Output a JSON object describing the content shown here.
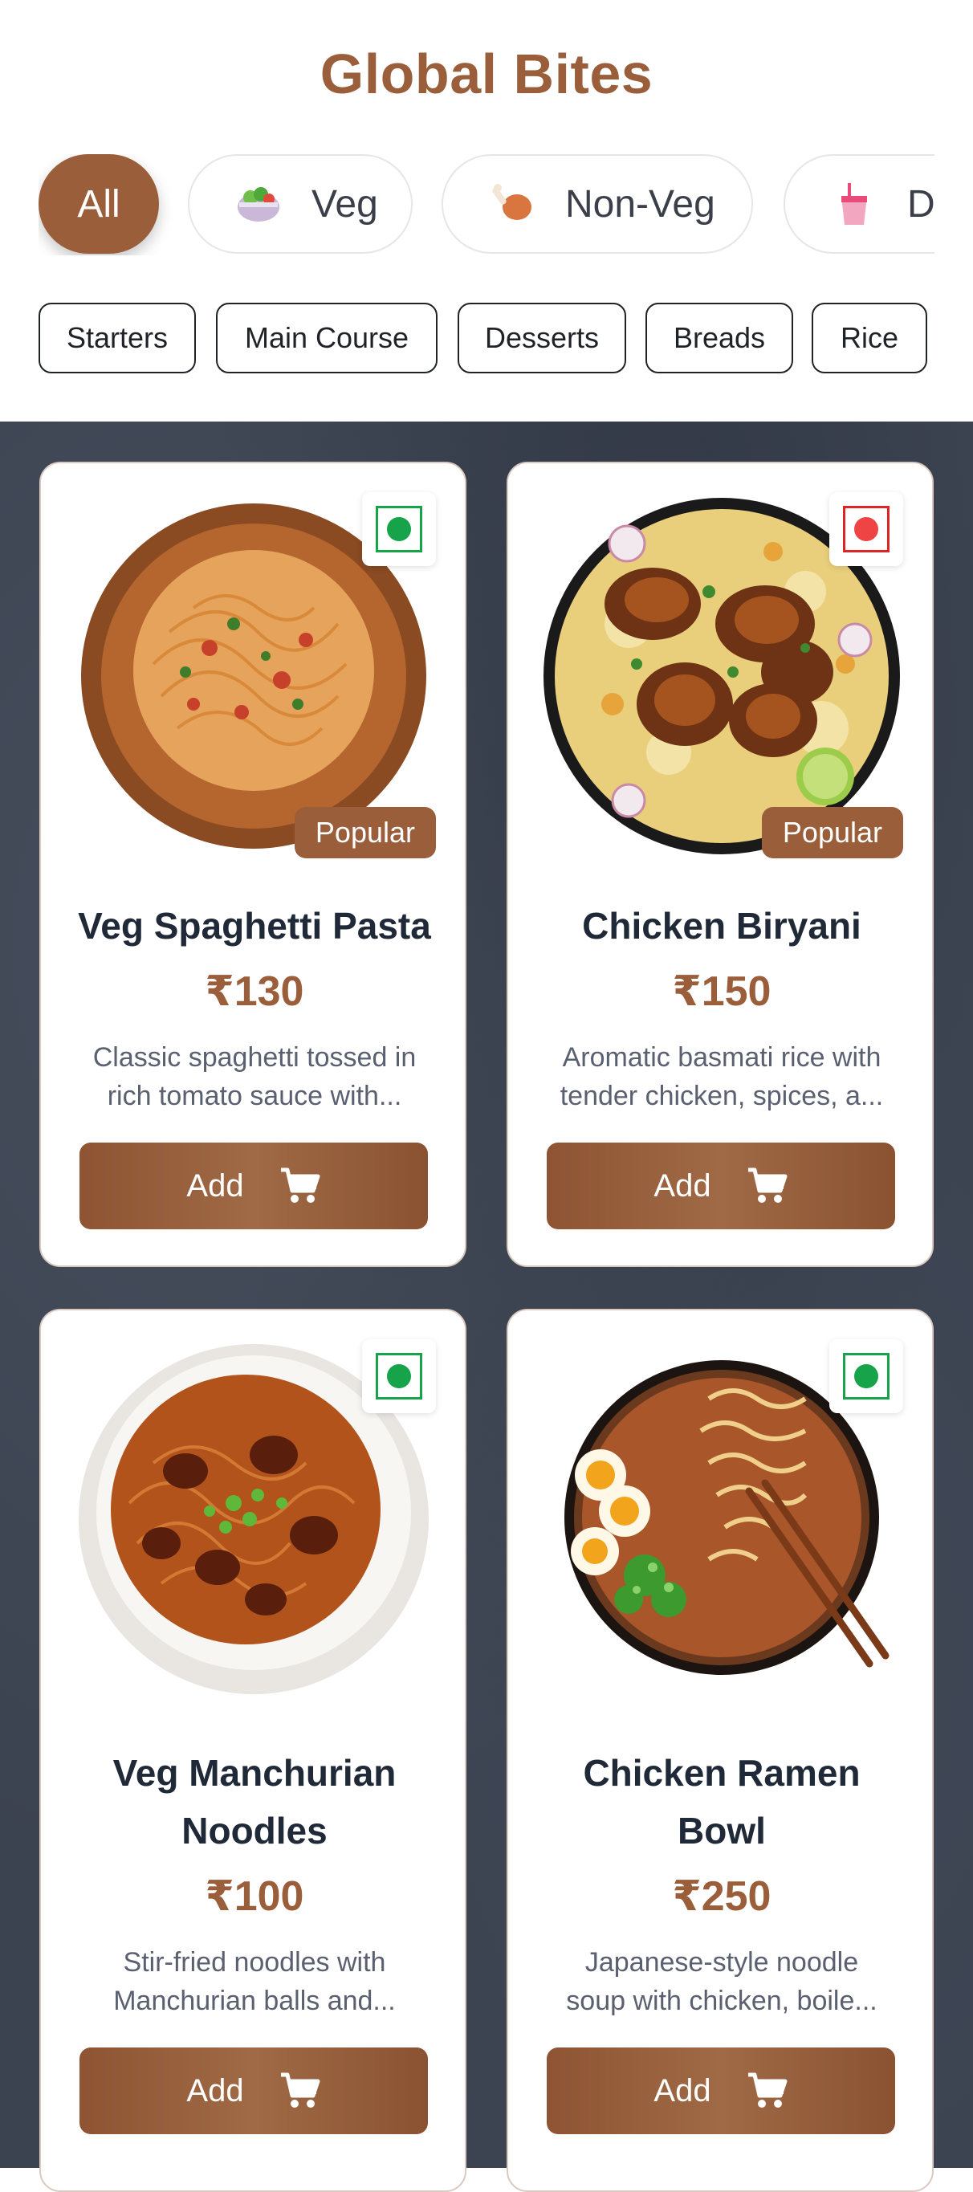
{
  "header": {
    "title": "Global Bites"
  },
  "filters": [
    {
      "label": "All",
      "icon": "",
      "active": true
    },
    {
      "label": "Veg",
      "icon": "salad-bowl-icon",
      "active": false
    },
    {
      "label": "Non-Veg",
      "icon": "chicken-leg-icon",
      "active": false
    },
    {
      "label": "Dr",
      "icon": "drink-cup-icon",
      "active": false
    }
  ],
  "categories": [
    "Starters",
    "Main Course",
    "Desserts",
    "Breads",
    "Rice"
  ],
  "items": [
    {
      "name": "Veg Spaghetti Pasta",
      "price": "₹130",
      "description_line1": "Classic spaghetti tossed in",
      "description_line2": "rich tomato sauce with...",
      "badge": "Popular",
      "type": "veg",
      "add_label": "Add"
    },
    {
      "name": "Chicken Biryani",
      "price": "₹150",
      "description_line1": "Aromatic basmati rice with",
      "description_line2": "tender chicken, spices, a...",
      "badge": "Popular",
      "type": "non-veg",
      "add_label": "Add"
    },
    {
      "name_line1": "Veg Manchurian",
      "name_line2": "Noodles",
      "price": "₹100",
      "description_line1": "Stir-fried noodles with",
      "description_line2": "Manchurian balls and...",
      "type": "veg",
      "add_label": "Add"
    },
    {
      "name_line1": "Chicken Ramen",
      "name_line2": "Bowl",
      "price": "₹250",
      "description_line1": "Japanese-style noodle",
      "description_line2": "soup with chicken, boile...",
      "type": "veg",
      "add_label": "Add"
    }
  ],
  "colors": {
    "accent": "#9a5e3a",
    "veg": "#16a34a",
    "nonveg": "#dc2626"
  }
}
